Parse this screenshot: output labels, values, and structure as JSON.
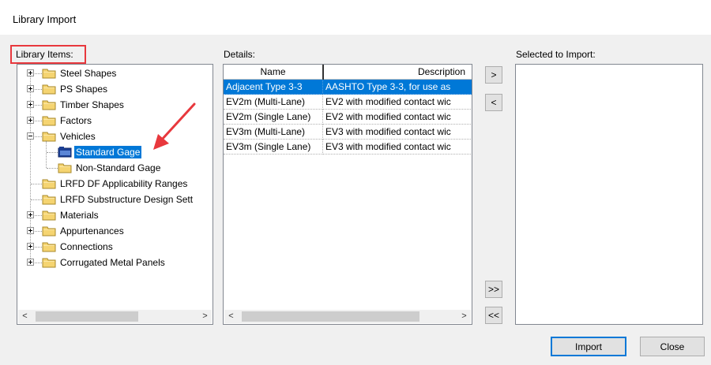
{
  "window": {
    "title": "Library Import"
  },
  "labels": {
    "library_items": "Library Items:",
    "details": "Details:",
    "selected_to_import": "Selected to Import:"
  },
  "tree": {
    "items": [
      {
        "label": "Steel Shapes",
        "expandable": true
      },
      {
        "label": "PS Shapes",
        "expandable": true
      },
      {
        "label": "Timber Shapes",
        "expandable": true
      },
      {
        "label": "Factors",
        "expandable": true
      },
      {
        "label": "Vehicles",
        "expandable": true,
        "expanded": true,
        "children": [
          {
            "label": "Standard Gage",
            "selected": true
          },
          {
            "label": "Non-Standard Gage"
          }
        ]
      },
      {
        "label": "LRFD DF Applicability Ranges",
        "expandable": false
      },
      {
        "label": "LRFD Substructure Design Sett",
        "expandable": false
      },
      {
        "label": "Materials",
        "expandable": true
      },
      {
        "label": "Appurtenances",
        "expandable": true
      },
      {
        "label": "Connections",
        "expandable": true
      },
      {
        "label": "Corrugated Metal Panels",
        "expandable": true
      }
    ]
  },
  "details_grid": {
    "columns": [
      "Name",
      "Description"
    ],
    "rows": [
      {
        "name": "Adjacent Type 3-3",
        "description": "AASHTO Type 3-3, for use as",
        "selected": true
      },
      {
        "name": "EV2m (Multi-Lane)",
        "description": "EV2 with modified contact wic"
      },
      {
        "name": "EV2m (Single Lane)",
        "description": "EV2 with modified contact wic"
      },
      {
        "name": "EV3m (Multi-Lane)",
        "description": "EV3 with modified contact wic"
      },
      {
        "name": "EV3m (Single Lane)",
        "description": "EV3 with modified contact wic"
      }
    ]
  },
  "transfer_buttons": {
    "add": ">",
    "remove": "<",
    "add_all": ">>",
    "remove_all": "<<"
  },
  "footer": {
    "import_label": "Import",
    "close_label": "Close"
  },
  "scroll": {
    "left_arrow": "<",
    "right_arrow": ">"
  },
  "colors": {
    "selection": "#0078d7",
    "callout": "#e8383d",
    "folder": "#f5d471"
  }
}
